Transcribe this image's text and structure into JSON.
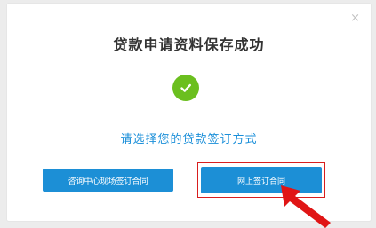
{
  "dialog": {
    "title": "贷款申请资料保存成功",
    "subtitle": "请选择您的贷款签订方式",
    "close_glyph": "×"
  },
  "buttons": {
    "onsite_label": "咨询中心现场签订合同",
    "online_label": "网上签订合同"
  },
  "icons": {
    "success": "check-circle-icon",
    "close": "close-icon",
    "pointer": "red-arrow-icon"
  },
  "colors": {
    "success_green": "#6bbf1f",
    "button_blue": "#1c8fd6",
    "subtitle_blue": "#1b8fd9",
    "highlight_red": "#d81e1e",
    "title_text": "#333333"
  }
}
